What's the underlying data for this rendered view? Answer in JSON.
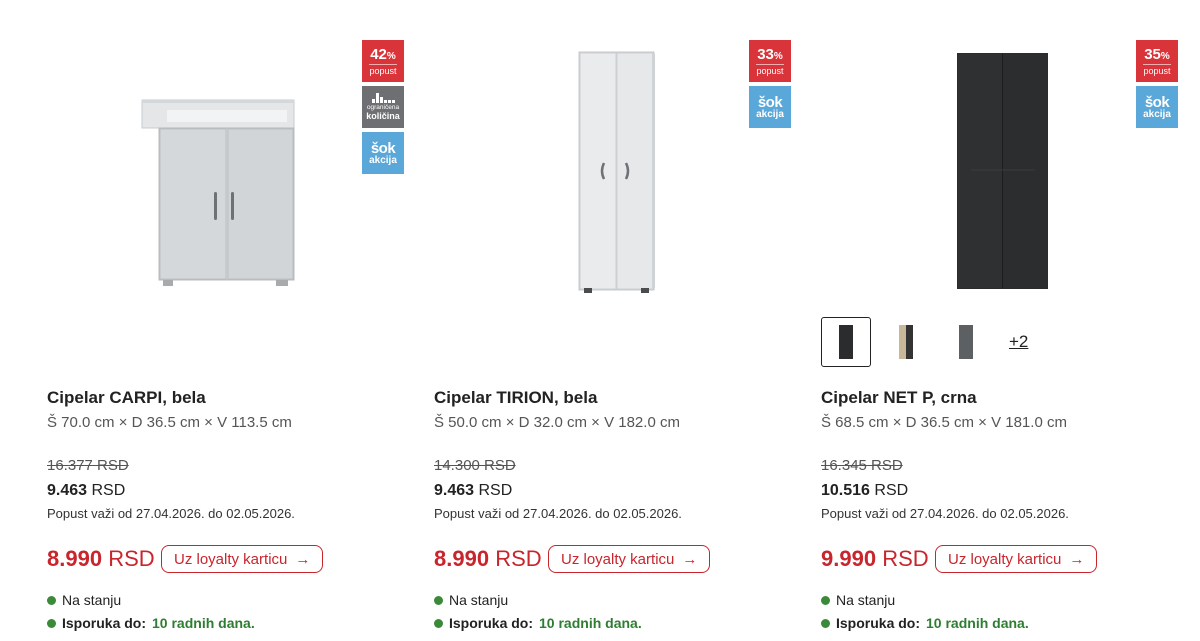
{
  "colors": {
    "sale_red": "#c8252c",
    "badge_red": "#d9343a",
    "badge_gray": "#6d6f72",
    "badge_blue": "#5aa7d9",
    "stock_green": "#3a8a3a"
  },
  "products": [
    {
      "badges": {
        "discount_pct": "42",
        "pct_sign": "%",
        "discount_label": "popust",
        "limited_line1": "ograničena",
        "limited_line2": "količina",
        "sok_line1": "šok",
        "sok_line2": "akcija"
      },
      "title": "Cipelar CARPI, bela",
      "dims": "Š 70.0 cm × D 36.5 cm × V 113.5 cm",
      "old_price": "16.377 RSD",
      "price_amount": "9.463",
      "price_currency": "RSD",
      "valid": "Popust važi od 27.04.2026. do 02.05.2026.",
      "loyalty_amount": "8.990",
      "loyalty_currency": "RSD",
      "loyalty_button": "Uz loyalty karticu",
      "arrow_icon": "→",
      "stock": "Na stanju",
      "delivery_label": "Isporuka do:",
      "delivery_days": "10 radnih dana."
    },
    {
      "badges": {
        "discount_pct": "33",
        "pct_sign": "%",
        "discount_label": "popust",
        "sok_line1": "šok",
        "sok_line2": "akcija"
      },
      "title": "Cipelar TIRION, bela",
      "dims": "Š 50.0 cm × D 32.0 cm × V 182.0 cm",
      "old_price": "14.300 RSD",
      "price_amount": "9.463",
      "price_currency": "RSD",
      "valid": "Popust važi od 27.04.2026. do 02.05.2026.",
      "loyalty_amount": "8.990",
      "loyalty_currency": "RSD",
      "loyalty_button": "Uz loyalty karticu",
      "arrow_icon": "→",
      "stock": "Na stanju",
      "delivery_label": "Isporuka do:",
      "delivery_days": "10 radnih dana."
    },
    {
      "badges": {
        "discount_pct": "35",
        "pct_sign": "%",
        "discount_label": "popust",
        "sok_line1": "šok",
        "sok_line2": "akcija"
      },
      "variants_more": "+2",
      "title": "Cipelar NET P, crna",
      "dims": "Š 68.5 cm × D 36.5 cm × V 181.0 cm",
      "old_price": "16.345 RSD",
      "price_amount": "10.516",
      "price_currency": "RSD",
      "valid": "Popust važi od 27.04.2026. do 02.05.2026.",
      "loyalty_amount": "9.990",
      "loyalty_currency": "RSD",
      "loyalty_button": "Uz loyalty karticu",
      "arrow_icon": "→",
      "stock": "Na stanju",
      "delivery_label": "Isporuka do:",
      "delivery_days": "10 radnih dana."
    }
  ]
}
